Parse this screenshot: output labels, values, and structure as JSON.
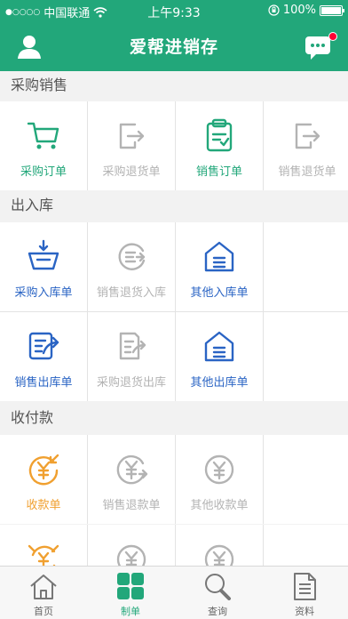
{
  "status_bar": {
    "carrier": "中国联通",
    "time": "上午9:33",
    "battery": "100%",
    "battery_level": 1.0
  },
  "nav": {
    "title": "爱帮进销存",
    "has_unread_message": true
  },
  "sections": [
    {
      "title": "采购销售",
      "items": [
        {
          "label": "采购订单",
          "icon": "shopping-cart-icon",
          "color": "#22a77a",
          "enabled": true
        },
        {
          "label": "采购退货单",
          "icon": "exit-arrow-icon",
          "color": "#b3b3b3",
          "enabled": false
        },
        {
          "label": "销售订单",
          "icon": "clipboard-check-icon",
          "color": "#22a77a",
          "enabled": true
        },
        {
          "label": "销售退货单",
          "icon": "exit-arrow-icon",
          "color": "#b3b3b3",
          "enabled": false
        }
      ]
    },
    {
      "title": "出入库",
      "items": [
        {
          "label": "采购入库单",
          "icon": "basket-in-icon",
          "color": "#2a64c4",
          "enabled": true
        },
        {
          "label": "销售退货入库",
          "icon": "return-in-icon",
          "color": "#b3b3b3",
          "enabled": false
        },
        {
          "label": "其他入库单",
          "icon": "warehouse-icon",
          "color": "#2a64c4",
          "enabled": true
        },
        {
          "label": "",
          "icon": "",
          "color": "",
          "enabled": false
        },
        {
          "label": "销售出库单",
          "icon": "document-out-icon",
          "color": "#2a64c4",
          "enabled": true
        },
        {
          "label": "采购退货出库",
          "icon": "document-return-icon",
          "color": "#b3b3b3",
          "enabled": false
        },
        {
          "label": "其他出库单",
          "icon": "warehouse-icon",
          "color": "#2a64c4",
          "enabled": true
        },
        {
          "label": "",
          "icon": "",
          "color": "",
          "enabled": false
        }
      ]
    },
    {
      "title": "收付款",
      "items": [
        {
          "label": "收款单",
          "icon": "yen-in-icon",
          "color": "#f0a030",
          "enabled": true
        },
        {
          "label": "销售退款单",
          "icon": "yen-return-icon",
          "color": "#b3b3b3",
          "enabled": false
        },
        {
          "label": "其他收款单",
          "icon": "yen-icon",
          "color": "#b3b3b3",
          "enabled": false
        },
        {
          "label": "",
          "icon": "",
          "color": "",
          "enabled": false
        }
      ]
    }
  ],
  "partial_row_icons": [
    "yen-exchange-icon",
    "yen-icon",
    "yen-icon"
  ],
  "tabbar": [
    {
      "label": "首页",
      "icon": "home-icon",
      "active": false
    },
    {
      "label": "制单",
      "icon": "grid-icon",
      "active": true
    },
    {
      "label": "查询",
      "icon": "search-icon",
      "active": false
    },
    {
      "label": "资料",
      "icon": "document-icon",
      "active": false
    }
  ],
  "colors": {
    "primary": "#22a77a",
    "blue": "#2a64c4",
    "orange": "#f0a030",
    "disabled": "#b3b3b3"
  }
}
